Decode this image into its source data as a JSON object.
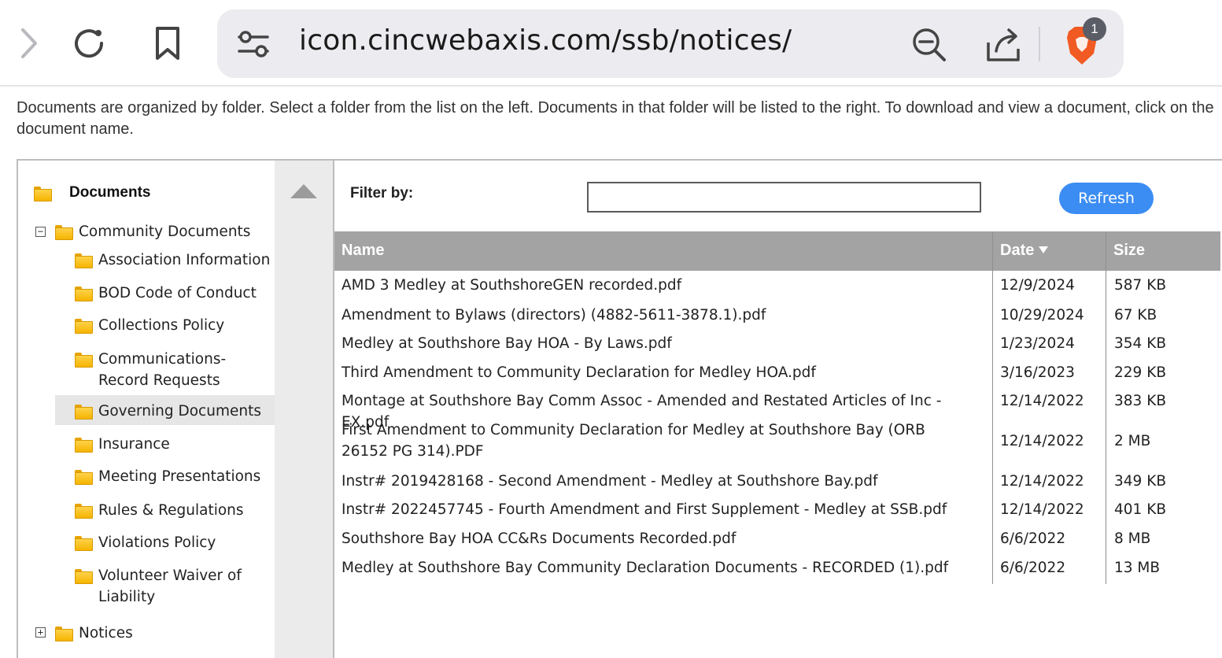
{
  "browser": {
    "url": "icon.cincwebaxis.com/ssb/notices/",
    "shield_badge_count": "1",
    "icons": [
      "forward-icon",
      "reload-icon",
      "bookmark-icon",
      "site-settings-icon",
      "zoom-out-icon",
      "share-icon",
      "brave-shield-icon"
    ]
  },
  "intro": {
    "text": "Documents are organized by folder. Select a folder from the list on the left. Documents in that folder will be listed to the right. To download and view a document, click on the document name."
  },
  "tree": {
    "root_label": "Documents",
    "community": {
      "label": "Community Documents",
      "expander": "−",
      "children": [
        {
          "label": "Association Information"
        },
        {
          "label": "BOD Code of Conduct"
        },
        {
          "label": "Collections Policy"
        },
        {
          "label": "Communications-Record Requests"
        },
        {
          "label": "Governing Documents",
          "selected": true
        },
        {
          "label": "Insurance"
        },
        {
          "label": "Meeting Presentations"
        },
        {
          "label": "Rules & Regulations"
        },
        {
          "label": "Violations Policy"
        },
        {
          "label": "Volunteer Waiver of Liability"
        }
      ]
    },
    "notices": {
      "label": "Notices",
      "expander": "+"
    }
  },
  "filter": {
    "label": "Filter by:",
    "value": "",
    "refresh_label": "Refresh"
  },
  "grid": {
    "columns": {
      "name": "Name",
      "date": "Date",
      "size": "Size"
    },
    "sort_column": "date",
    "sort_direction": "descending",
    "rows": [
      {
        "name": "AMD 3 Medley at SouthshoreGEN recorded.pdf",
        "date": "12/9/2024",
        "size": "587 KB"
      },
      {
        "name": "Amendment to Bylaws (directors) (4882-5611-3878.1).pdf",
        "date": "10/29/2024",
        "size": "67 KB"
      },
      {
        "name": "Medley at Southshore Bay HOA - By Laws.pdf",
        "date": "1/23/2024",
        "size": "354 KB"
      },
      {
        "name": "Third Amendment to Community Declaration for Medley HOA.pdf",
        "date": "3/16/2023",
        "size": "229 KB"
      },
      {
        "name": "Montage at Southshore Bay Comm Assoc - Amended and Restated Articles of Inc - EX.pdf",
        "date": "12/14/2022",
        "size": "383 KB"
      },
      {
        "name": "First Amendment to Community Declaration for Medley at Southshore Bay (ORB 26152 PG 314).PDF",
        "date": "12/14/2022",
        "size": "2 MB"
      },
      {
        "name": "Instr# 2019428168 - Second Amendment - Medley at Southshore Bay.pdf",
        "date": "12/14/2022",
        "size": "349 KB"
      },
      {
        "name": "Instr# 2022457745 - Fourth Amendment and First Supplement - Medley at SSB.pdf",
        "date": "12/14/2022",
        "size": "401 KB"
      },
      {
        "name": "Southshore Bay HOA CC&Rs Documents Recorded.pdf",
        "date": "6/6/2022",
        "size": "8 MB"
      },
      {
        "name": "Medley at Southshore Bay Community Declaration Documents - RECORDED (1).pdf",
        "date": "6/6/2022",
        "size": "13 MB"
      }
    ]
  },
  "colors": {
    "accent": "#3b8df3",
    "header_bg": "#a3a3a3",
    "folder": "#f5b400",
    "selected_bg": "#e6e6e6",
    "brave": "#f15a22"
  }
}
